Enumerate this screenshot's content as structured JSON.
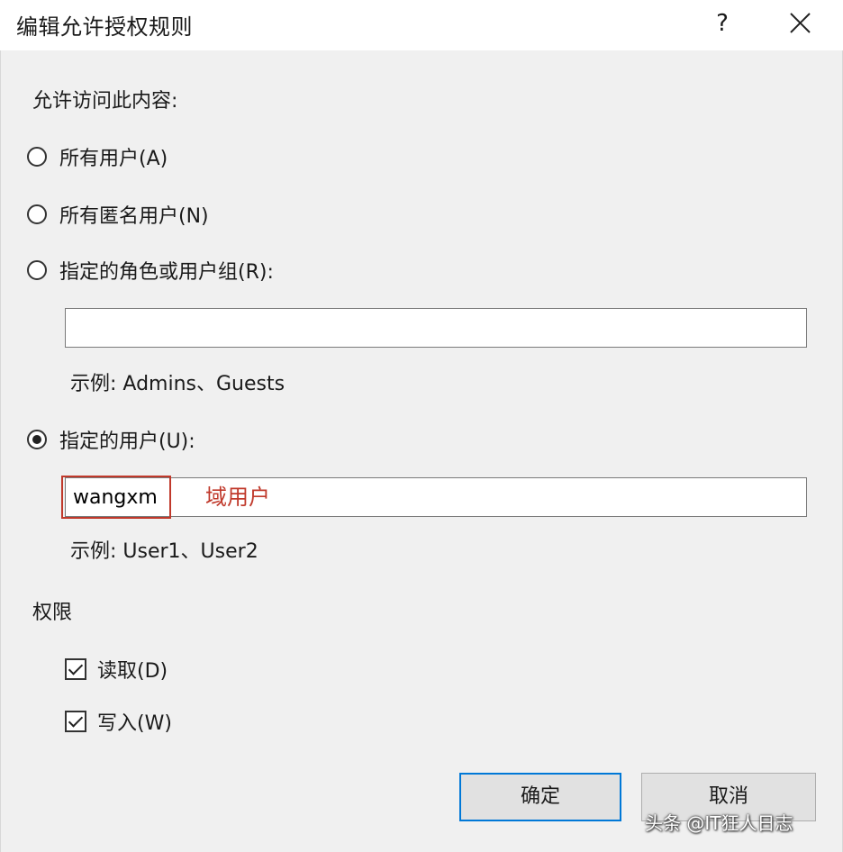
{
  "window": {
    "title": "编辑允许授权规则",
    "help_label": "?"
  },
  "access": {
    "heading": "允许访问此内容:",
    "options": [
      {
        "label": "所有用户(A)",
        "checked": false
      },
      {
        "label": "所有匿名用户(N)",
        "checked": false
      },
      {
        "label": "指定的角色或用户组(R):",
        "checked": false
      },
      {
        "label": "指定的用户(U):",
        "checked": true
      }
    ],
    "roles_value": "",
    "roles_example": "示例: Admins、Guests",
    "users_value": "wangxm",
    "users_example": "示例: User1、User2",
    "annotation": "域用户"
  },
  "permissions": {
    "heading": "权限",
    "items": [
      {
        "label": "读取(D)",
        "checked": true
      },
      {
        "label": "写入(W)",
        "checked": true
      }
    ]
  },
  "buttons": {
    "ok": "确定",
    "cancel": "取消"
  },
  "watermark": "头条 @IT狂人日志",
  "colors": {
    "annotation": "#c0392b",
    "primary_border": "#0078d7",
    "client_bg": "#f0f0f0"
  }
}
